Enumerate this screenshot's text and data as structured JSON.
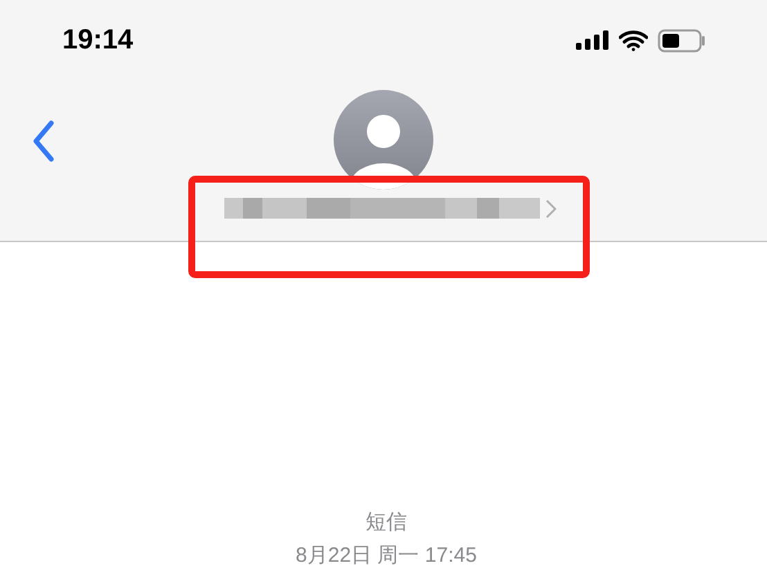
{
  "status_bar": {
    "time": "19:14"
  },
  "header": {
    "contact": {
      "name_hidden": true,
      "highlighted": true
    }
  },
  "conversation": {
    "service": "短信",
    "timestamp": "8月22日 周一 17:45"
  }
}
